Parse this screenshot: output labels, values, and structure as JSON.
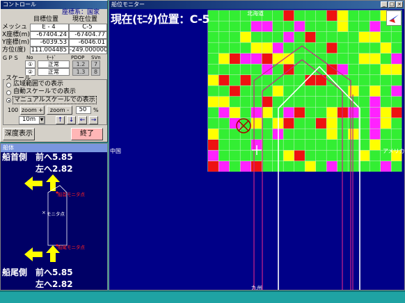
{
  "control": {
    "window_title": "コントロール",
    "coord_system": "座標系：国家",
    "col_target": "目標位置",
    "col_current": "現在位置",
    "rows": [
      {
        "label": "メッシュ",
        "target": "E - 4",
        "current": "C-5"
      },
      {
        "label": "X座標(m)",
        "target": "-67404.24",
        "current": "-67404.77"
      },
      {
        "label": "Y座標(m)",
        "target": "-6039.53",
        "current": "-6046.01"
      },
      {
        "label": "方位(度)",
        "target": "111.004485",
        "current": "-249.000000"
      }
    ],
    "gps": {
      "label": "ＧＰＳ",
      "headers": [
        "No",
        "ﾓｰﾄﾞ",
        "PDOP",
        "SVn"
      ],
      "rows": [
        {
          "no": "①",
          "mode": "正常",
          "pdop": "1.2",
          "svn": "7"
        },
        {
          "no": "②",
          "mode": "正常",
          "pdop": "1.3",
          "svn": "8"
        }
      ]
    },
    "scale": {
      "group_label": "スケール",
      "options": [
        "広域範囲での表示",
        "自動スケールでの表示",
        "マニュアルスケールでの表示"
      ],
      "selected": 2,
      "value": "100",
      "zoom_in": "zoom +",
      "zoom_out": "zoom -",
      "zoom_value": "50",
      "zoom_unit": "%",
      "step": "10m",
      "arrows": [
        "↑",
        "↓",
        "←",
        "→"
      ]
    },
    "depth_button": "深度表示",
    "exit_button": "終了"
  },
  "hull": {
    "window_title": "船体",
    "bow_label": "船首側",
    "bow_fwd": "前へ5.85",
    "bow_left": "左へ2.82",
    "stern_label": "船尾側",
    "stern_fwd": "前へ5.85",
    "stern_left": "左へ2.82",
    "bow_point": "船首モニタ点",
    "center_point": "モニタ点",
    "stern_point": "船尾モニタ点",
    "arrow_color": "#ffff00"
  },
  "monitor": {
    "window_title": "船位モニター",
    "position_title": "現在(ﾓﾆﾀ)位置：C-5",
    "regions": {
      "north": "北海道",
      "west": "中国",
      "east": "アメリカ",
      "south": "九州"
    },
    "grid_colors": {
      "green": "#33ee33",
      "yellow": "#ffff00",
      "red": "#ee1111",
      "magenta": "#ff22ff"
    },
    "window_buttons": [
      "_",
      "□",
      "×"
    ]
  }
}
